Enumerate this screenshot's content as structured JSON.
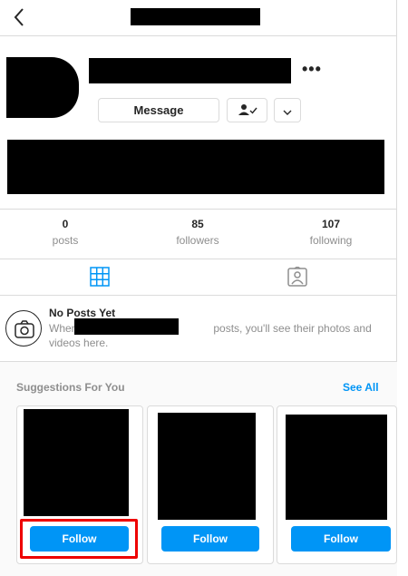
{
  "header": {
    "back_icon": "chevron-left-icon"
  },
  "profile": {
    "message_label": "Message",
    "more_label": "•••"
  },
  "stats": [
    {
      "value": "0",
      "label": "posts"
    },
    {
      "value": "85",
      "label": "followers"
    },
    {
      "value": "107",
      "label": "following"
    }
  ],
  "tabs": [
    {
      "icon": "grid-icon",
      "active": true
    },
    {
      "icon": "tagged-icon",
      "active": false
    }
  ],
  "no_posts": {
    "title": "No Posts Yet",
    "text_before": "When",
    "text_after": "posts, you'll see their photos and videos here."
  },
  "suggestions": {
    "title": "Suggestions For You",
    "see_all": "See All",
    "cards": [
      {
        "follow_label": "Follow"
      },
      {
        "follow_label": "Follow"
      },
      {
        "follow_label": "Follow"
      }
    ]
  },
  "colors": {
    "accent": "#0095f6",
    "highlight": "#e00000",
    "border": "#dbdbdb"
  }
}
